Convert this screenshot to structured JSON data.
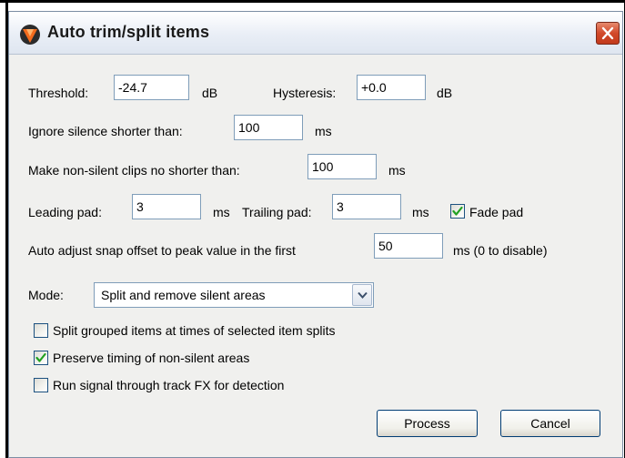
{
  "window": {
    "title": "Auto trim/split items"
  },
  "threshold": {
    "label": "Threshold:",
    "value": "-24.7",
    "unit": "dB"
  },
  "hysteresis": {
    "label": "Hysteresis:",
    "value": "+0.0",
    "unit": "dB"
  },
  "ignore_silence": {
    "label": "Ignore silence shorter than:",
    "value": "100",
    "unit": "ms"
  },
  "min_clip": {
    "label": "Make non-silent clips no shorter than:",
    "value": "100",
    "unit": "ms"
  },
  "leading_pad": {
    "label": "Leading pad:",
    "value": "3",
    "unit": "ms"
  },
  "trailing_pad": {
    "label": "Trailing pad:",
    "value": "3",
    "unit": "ms"
  },
  "fade_pad": {
    "label": "Fade pad",
    "checked": true
  },
  "snap_offset": {
    "label": "Auto adjust snap offset to peak value in the first",
    "value": "50",
    "unit": "ms (0 to disable)"
  },
  "mode": {
    "label": "Mode:",
    "selected": "Split and remove silent areas"
  },
  "options": [
    {
      "label": "Split grouped items at times of selected item splits",
      "checked": false
    },
    {
      "label": "Preserve timing of non-silent areas",
      "checked": true
    },
    {
      "label": "Run signal through track FX for detection",
      "checked": false
    }
  ],
  "buttons": {
    "process": "Process",
    "cancel": "Cancel"
  },
  "icons": {
    "app": "reaper-logo-icon",
    "close": "close-icon",
    "dropdown": "chevron-down-icon",
    "check": "checkmark-icon"
  },
  "colors": {
    "close_button": "#d2492a",
    "title_bar": "#e9eef6",
    "dialog_bg": "#f0f0ee",
    "checkmark": "#21a121"
  }
}
